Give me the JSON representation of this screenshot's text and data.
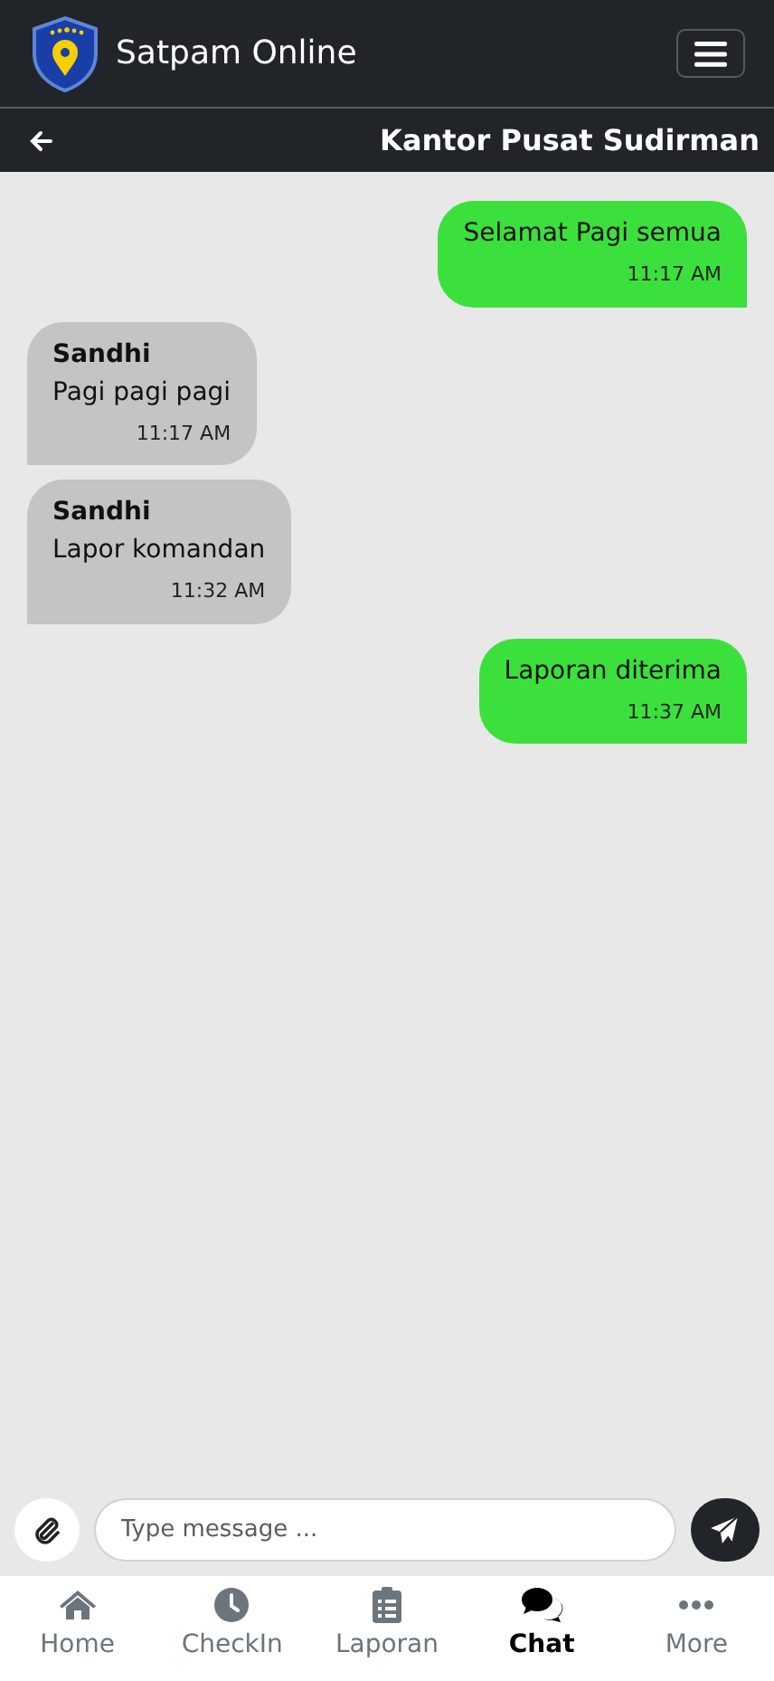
{
  "app": {
    "title": "Satpam Online"
  },
  "chat": {
    "title": "Kantor Pusat Sudirman"
  },
  "messages": [
    {
      "kind": "outgoing",
      "text": "Selamat Pagi semua",
      "time": "11:17 AM"
    },
    {
      "kind": "incoming",
      "sender": "Sandhi",
      "text": "Pagi pagi pagi",
      "time": "11:17 AM"
    },
    {
      "kind": "incoming",
      "sender": "Sandhi",
      "text": "Lapor komandan",
      "time": "11:32 AM"
    },
    {
      "kind": "outgoing",
      "text": "Laporan diterima",
      "time": "11:37 AM"
    }
  ],
  "composer": {
    "placeholder": "Type message ..."
  },
  "bottom_nav": [
    {
      "kind": "home",
      "label": "Home",
      "selected": false
    },
    {
      "kind": "clock",
      "label": "CheckIn",
      "selected": false
    },
    {
      "kind": "clipboard",
      "label": "Laporan",
      "selected": false
    },
    {
      "kind": "chat",
      "label": "Chat",
      "selected": true
    },
    {
      "kind": "more",
      "label": "More",
      "selected": false
    }
  ]
}
